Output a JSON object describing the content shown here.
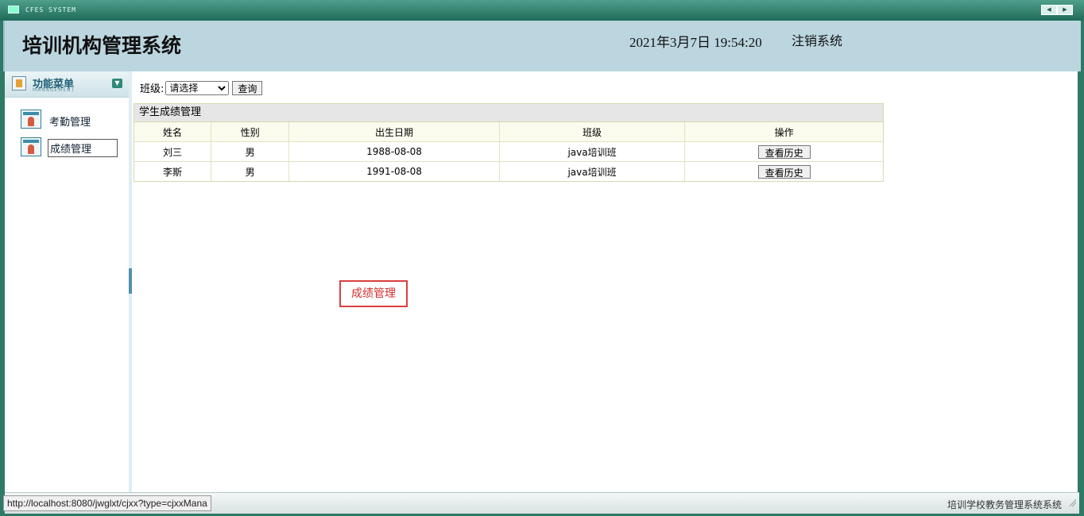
{
  "window": {
    "system_label": "CFES SYSTEM"
  },
  "header": {
    "title": "培训机构管理系统",
    "datetime": "2021年3月7日 19:54:20",
    "logout_label": "注销系统"
  },
  "sidebar": {
    "menu_title": "功能菜单",
    "menu_subtitle": "MANAGEMENT",
    "items": [
      {
        "label": "考勤管理",
        "icon": "user-card-icon",
        "active": false
      },
      {
        "label": "成绩管理",
        "icon": "user-card-icon",
        "active": true
      }
    ]
  },
  "filter": {
    "label": "班级:",
    "select_value": "请选择",
    "query_label": "查询"
  },
  "grid": {
    "title": "学生成绩管理",
    "columns": [
      "姓名",
      "性别",
      "出生日期",
      "班级",
      "操作"
    ],
    "rows": [
      {
        "name": "刘三",
        "gender": "男",
        "birth": "1988-08-08",
        "class": "java培训班",
        "action": "查看历史"
      },
      {
        "name": "李斯",
        "gender": "男",
        "birth": "1991-08-08",
        "class": "java培训班",
        "action": "查看历史"
      }
    ]
  },
  "tooltip": {
    "text": "成绩管理"
  },
  "statusbar": {
    "url": "http://localhost:8080/jwglxt/cjxx?type=cjxxMana",
    "right_text": "培训学校教务管理系统系统"
  },
  "colors": {
    "frame": "#2e7a66",
    "header_bg": "#bcd6e0",
    "tooltip_border": "#d94040"
  }
}
